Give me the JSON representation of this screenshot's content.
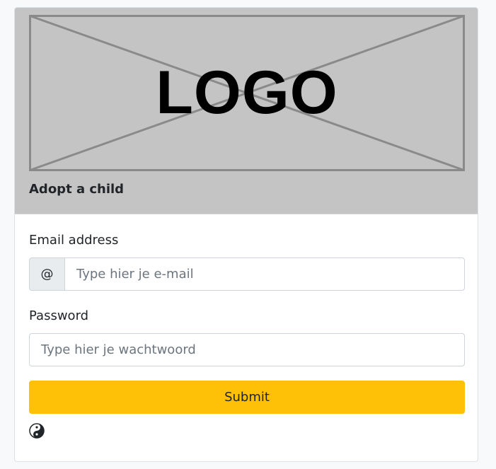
{
  "header": {
    "logo_text": "LOGO",
    "title": "Adopt a child"
  },
  "form": {
    "email": {
      "label": "Email address",
      "prefix": "@",
      "placeholder": "Type hier je e-mail",
      "value": ""
    },
    "password": {
      "label": "Password",
      "placeholder": "Type hier je wachtwoord",
      "value": ""
    },
    "submit_label": "Submit"
  },
  "theme_toggle": {
    "icon": "yin-yang-icon"
  },
  "colors": {
    "header_bg": "#c4c4c4",
    "accent": "#ffc107",
    "page_bg": "#f8f9fa"
  }
}
